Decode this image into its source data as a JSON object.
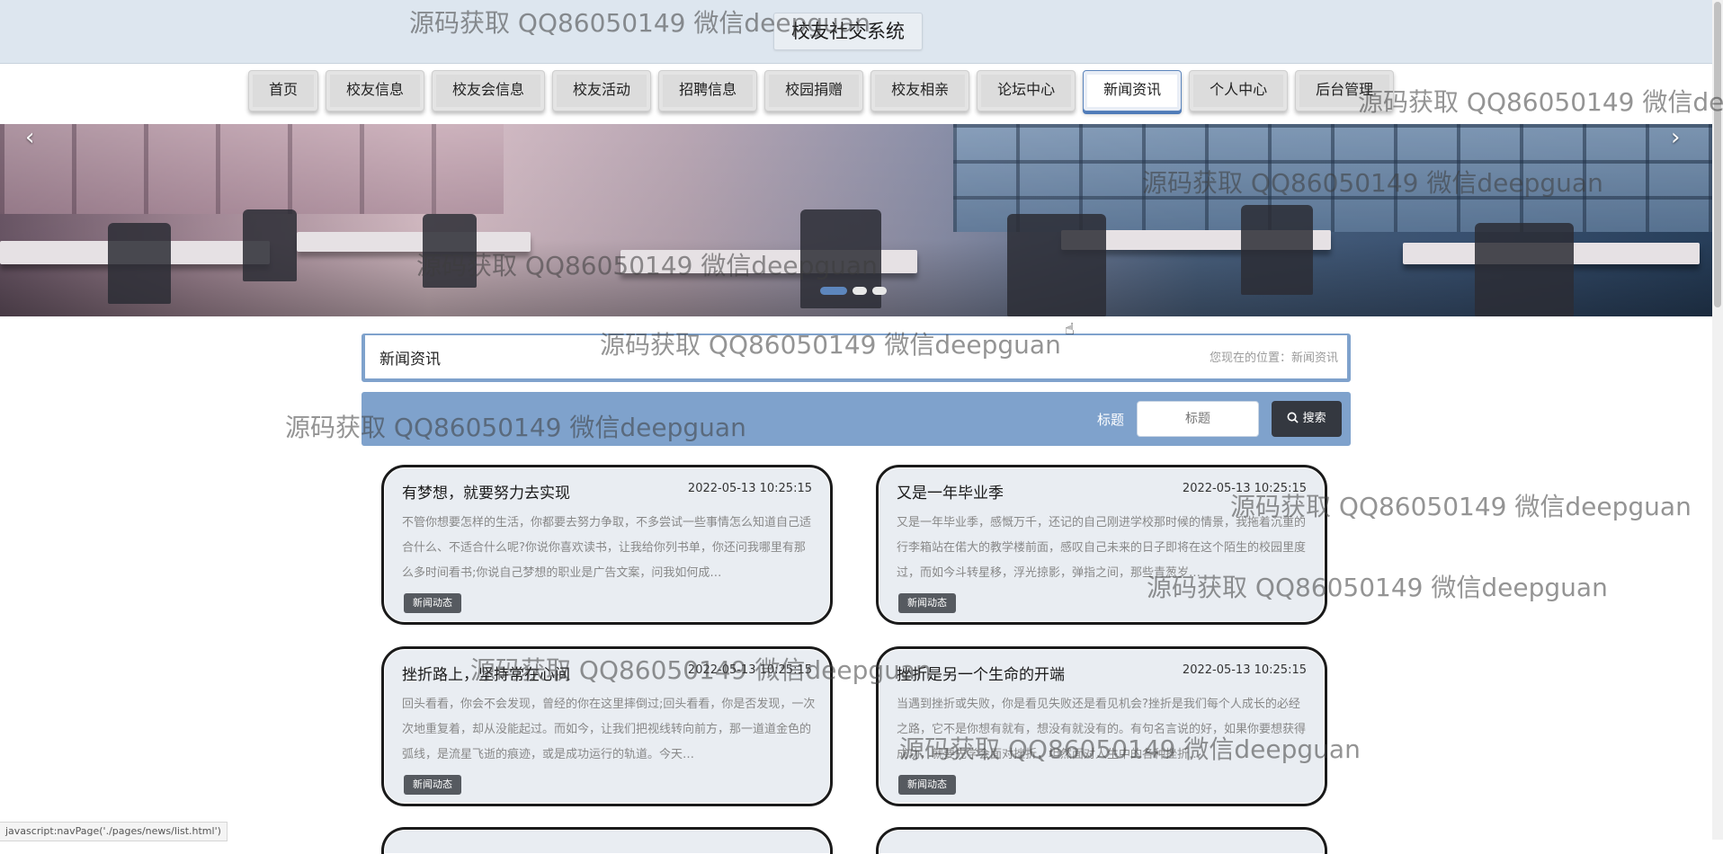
{
  "header": {
    "site_title": "校友社交系统"
  },
  "nav": {
    "items": [
      {
        "label": "首页"
      },
      {
        "label": "校友信息"
      },
      {
        "label": "校友会信息"
      },
      {
        "label": "校友活动"
      },
      {
        "label": "招聘信息"
      },
      {
        "label": "校园捐赠"
      },
      {
        "label": "校友相亲"
      },
      {
        "label": "论坛中心"
      },
      {
        "label": "新闻资讯",
        "active": true
      },
      {
        "label": "个人中心"
      },
      {
        "label": "后台管理"
      }
    ]
  },
  "banner": {
    "prev_icon": "‹",
    "next_icon": "›",
    "slide_count": 3,
    "active_slide": 1
  },
  "section": {
    "title": "新闻资讯",
    "breadcrumb": "您现在的位置：新闻资讯"
  },
  "search": {
    "label": "标题",
    "placeholder": "标题",
    "button_label": "搜索",
    "button_icon": "search-icon"
  },
  "news": [
    {
      "title": "有梦想，就要努力去实现",
      "date": "2022-05-13 10:25:15",
      "excerpt": "不管你想要怎样的生活，你都要去努力争取，不多尝试一些事情怎么知道自己适合什么、不适合什么呢?你说你喜欢读书，让我给你列书单，你还问我哪里有那么多时间看书;你说自己梦想的职业是广告文案，问我如何成…",
      "tag": "新闻动态"
    },
    {
      "title": "又是一年毕业季",
      "date": "2022-05-13 10:25:15",
      "excerpt": "又是一年毕业季，感慨万千，还记的自己刚进学校那时候的情景，我拖着沉重的行李箱站在偌大的教学楼前面，感叹自己未来的日子即将在这个陌生的校园里度过，而如今斗转星移，浮光掠影，弹指之间，那些青葱岁…",
      "tag": "新闻动态"
    },
    {
      "title": "挫折路上，坚持常在心间",
      "date": "2022-05-13 10:25:15",
      "excerpt": "回头看看，你会不会发现，曾经的你在这里摔倒过;回头看看，你是否发现，一次次地重复着，却从没能起过。而如今，让我们把视线转向前方，那一道道金色的弧线，是流星飞逝的痕迹，或是成功运行的轨道。今天…",
      "tag": "新闻动态"
    },
    {
      "title": "挫折是另一个生命的开端",
      "date": "2022-05-13 10:25:15",
      "excerpt": "当遇到挫折或失败，你是看见失败还是看见机会?挫折是我们每个人成长的必经之路，它不是你想有就有，想没有就没有的。有句名言说的好，如果你要想获得成功，就要先学会面对挫折，坦然面对人生中的各种挫折…",
      "tag": "新闻动态"
    }
  ],
  "status_bar": {
    "text": "javascript:navPage('./pages/news/list.html')"
  },
  "watermark": "源码获取 QQ86050149 微信deepguan"
}
